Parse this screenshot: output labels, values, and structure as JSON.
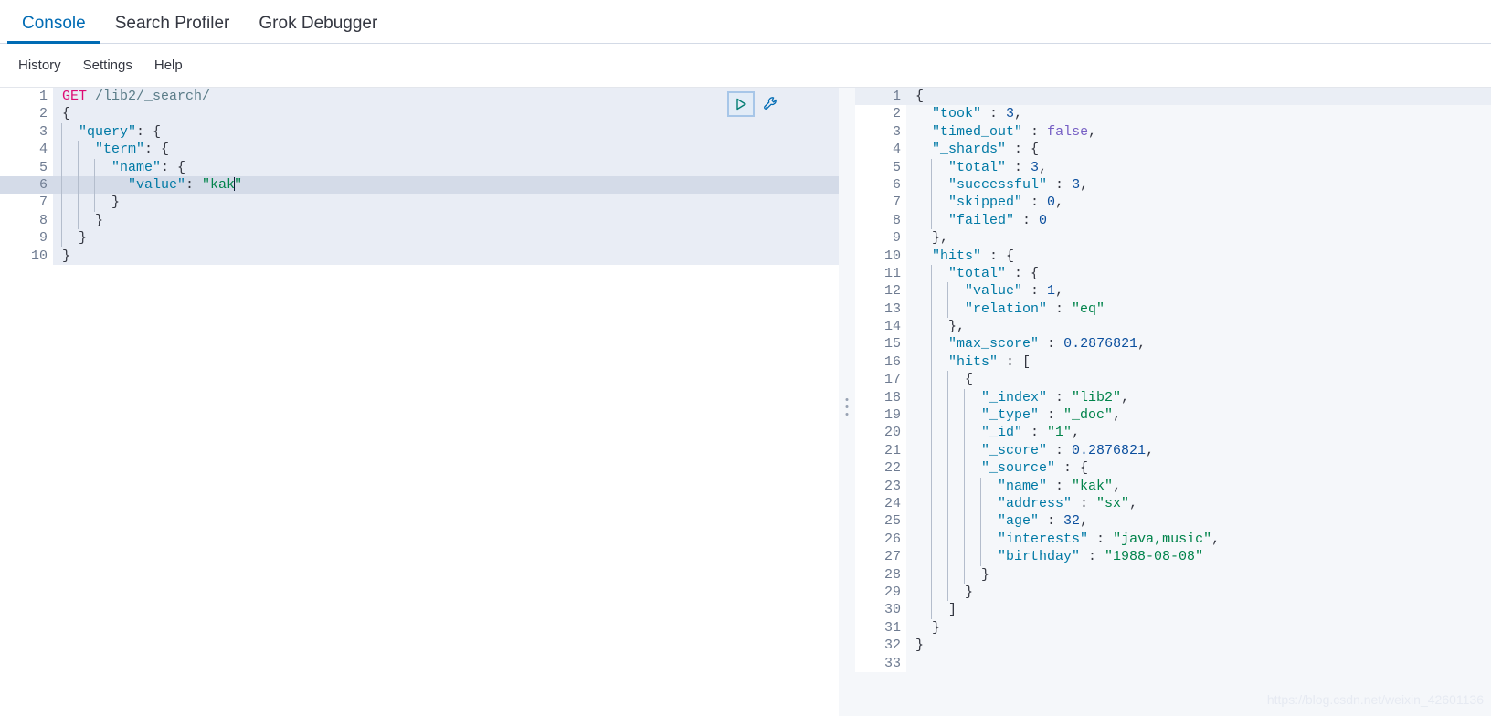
{
  "app": {
    "tabs": [
      {
        "label": "Console",
        "active": true
      },
      {
        "label": "Search Profiler",
        "active": false
      },
      {
        "label": "Grok Debugger",
        "active": false
      }
    ],
    "sub_nav": [
      {
        "label": "History"
      },
      {
        "label": "Settings"
      },
      {
        "label": "Help"
      }
    ],
    "watermark": "https://blog.csdn.net/weixin_42601136",
    "colors": {
      "accent": "#006bb4",
      "method": "#dd0a73",
      "key": "#0079a5",
      "string": "#00834a",
      "number": "#0b4f9e",
      "boolean": "#765fc4",
      "play_icon": "#017d73",
      "wrench_icon": "#006bb4",
      "active_line": "#d4dbe8",
      "request_block": "#e9edf5",
      "output_bg": "#f5f7fa"
    }
  },
  "toolbar": {
    "play_label": "Click to send request",
    "wrench_label": "Open documentation / settings"
  },
  "request_editor": {
    "name": "console-request-editor",
    "cursor_line": 6,
    "lines": [
      {
        "n": 1,
        "fold": "",
        "indent": 0,
        "tokens": [
          {
            "t": "method",
            "v": "GET"
          },
          {
            "t": "plain",
            "v": " "
          },
          {
            "t": "url",
            "v": "/lib2/_search/"
          }
        ]
      },
      {
        "n": 2,
        "fold": "open",
        "indent": 0,
        "tokens": [
          {
            "t": "punc",
            "v": "{"
          }
        ]
      },
      {
        "n": 3,
        "fold": "open",
        "indent": 1,
        "tokens": [
          {
            "t": "plain",
            "v": "  "
          },
          {
            "t": "key",
            "v": "\"query\""
          },
          {
            "t": "punc",
            "v": ": {"
          }
        ]
      },
      {
        "n": 4,
        "fold": "open",
        "indent": 2,
        "tokens": [
          {
            "t": "plain",
            "v": "    "
          },
          {
            "t": "key",
            "v": "\"term\""
          },
          {
            "t": "punc",
            "v": ": {"
          }
        ]
      },
      {
        "n": 5,
        "fold": "open",
        "indent": 3,
        "tokens": [
          {
            "t": "plain",
            "v": "      "
          },
          {
            "t": "key",
            "v": "\"name\""
          },
          {
            "t": "punc",
            "v": ": {"
          }
        ]
      },
      {
        "n": 6,
        "fold": "",
        "indent": 4,
        "tokens": [
          {
            "t": "plain",
            "v": "        "
          },
          {
            "t": "key",
            "v": "\"value\""
          },
          {
            "t": "punc",
            "v": ": "
          },
          {
            "t": "string",
            "v": "\"kak"
          },
          {
            "t": "caret",
            "v": ""
          },
          {
            "t": "string",
            "v": "\""
          }
        ]
      },
      {
        "n": 7,
        "fold": "close",
        "indent": 3,
        "tokens": [
          {
            "t": "plain",
            "v": "      "
          },
          {
            "t": "punc",
            "v": "}"
          }
        ]
      },
      {
        "n": 8,
        "fold": "close",
        "indent": 2,
        "tokens": [
          {
            "t": "plain",
            "v": "    "
          },
          {
            "t": "punc",
            "v": "}"
          }
        ]
      },
      {
        "n": 9,
        "fold": "close",
        "indent": 1,
        "tokens": [
          {
            "t": "plain",
            "v": "  "
          },
          {
            "t": "punc",
            "v": "}"
          }
        ]
      },
      {
        "n": 10,
        "fold": "close",
        "indent": 0,
        "tokens": [
          {
            "t": "punc",
            "v": "}"
          }
        ]
      }
    ],
    "request": {
      "method": "GET",
      "path": "/lib2/_search/",
      "body": {
        "query": {
          "term": {
            "name": {
              "value": "kak"
            }
          }
        }
      }
    }
  },
  "response_editor": {
    "name": "console-response-viewer",
    "cursor_line": 1,
    "lines": [
      {
        "n": 1,
        "fold": "open",
        "indent": 0,
        "tokens": [
          {
            "t": "punc",
            "v": "{"
          }
        ]
      },
      {
        "n": 2,
        "fold": "",
        "indent": 1,
        "tokens": [
          {
            "t": "plain",
            "v": "  "
          },
          {
            "t": "key",
            "v": "\"took\""
          },
          {
            "t": "punc",
            "v": " : "
          },
          {
            "t": "num",
            "v": "3"
          },
          {
            "t": "punc",
            "v": ","
          }
        ]
      },
      {
        "n": 3,
        "fold": "",
        "indent": 1,
        "tokens": [
          {
            "t": "plain",
            "v": "  "
          },
          {
            "t": "key",
            "v": "\"timed_out\""
          },
          {
            "t": "punc",
            "v": " : "
          },
          {
            "t": "bool",
            "v": "false"
          },
          {
            "t": "punc",
            "v": ","
          }
        ]
      },
      {
        "n": 4,
        "fold": "open",
        "indent": 1,
        "tokens": [
          {
            "t": "plain",
            "v": "  "
          },
          {
            "t": "key",
            "v": "\"_shards\""
          },
          {
            "t": "punc",
            "v": " : {"
          }
        ]
      },
      {
        "n": 5,
        "fold": "",
        "indent": 2,
        "tokens": [
          {
            "t": "plain",
            "v": "    "
          },
          {
            "t": "key",
            "v": "\"total\""
          },
          {
            "t": "punc",
            "v": " : "
          },
          {
            "t": "num",
            "v": "3"
          },
          {
            "t": "punc",
            "v": ","
          }
        ]
      },
      {
        "n": 6,
        "fold": "",
        "indent": 2,
        "tokens": [
          {
            "t": "plain",
            "v": "    "
          },
          {
            "t": "key",
            "v": "\"successful\""
          },
          {
            "t": "punc",
            "v": " : "
          },
          {
            "t": "num",
            "v": "3"
          },
          {
            "t": "punc",
            "v": ","
          }
        ]
      },
      {
        "n": 7,
        "fold": "",
        "indent": 2,
        "tokens": [
          {
            "t": "plain",
            "v": "    "
          },
          {
            "t": "key",
            "v": "\"skipped\""
          },
          {
            "t": "punc",
            "v": " : "
          },
          {
            "t": "num",
            "v": "0"
          },
          {
            "t": "punc",
            "v": ","
          }
        ]
      },
      {
        "n": 8,
        "fold": "",
        "indent": 2,
        "tokens": [
          {
            "t": "plain",
            "v": "    "
          },
          {
            "t": "key",
            "v": "\"failed\""
          },
          {
            "t": "punc",
            "v": " : "
          },
          {
            "t": "num",
            "v": "0"
          }
        ]
      },
      {
        "n": 9,
        "fold": "close",
        "indent": 1,
        "tokens": [
          {
            "t": "plain",
            "v": "  "
          },
          {
            "t": "punc",
            "v": "},"
          }
        ]
      },
      {
        "n": 10,
        "fold": "open",
        "indent": 1,
        "tokens": [
          {
            "t": "plain",
            "v": "  "
          },
          {
            "t": "key",
            "v": "\"hits\""
          },
          {
            "t": "punc",
            "v": " : {"
          }
        ]
      },
      {
        "n": 11,
        "fold": "open",
        "indent": 2,
        "tokens": [
          {
            "t": "plain",
            "v": "    "
          },
          {
            "t": "key",
            "v": "\"total\""
          },
          {
            "t": "punc",
            "v": " : {"
          }
        ]
      },
      {
        "n": 12,
        "fold": "",
        "indent": 3,
        "tokens": [
          {
            "t": "plain",
            "v": "      "
          },
          {
            "t": "key",
            "v": "\"value\""
          },
          {
            "t": "punc",
            "v": " : "
          },
          {
            "t": "num",
            "v": "1"
          },
          {
            "t": "punc",
            "v": ","
          }
        ]
      },
      {
        "n": 13,
        "fold": "",
        "indent": 3,
        "tokens": [
          {
            "t": "plain",
            "v": "      "
          },
          {
            "t": "key",
            "v": "\"relation\""
          },
          {
            "t": "punc",
            "v": " : "
          },
          {
            "t": "string",
            "v": "\"eq\""
          }
        ]
      },
      {
        "n": 14,
        "fold": "close",
        "indent": 2,
        "tokens": [
          {
            "t": "plain",
            "v": "    "
          },
          {
            "t": "punc",
            "v": "},"
          }
        ]
      },
      {
        "n": 15,
        "fold": "",
        "indent": 2,
        "tokens": [
          {
            "t": "plain",
            "v": "    "
          },
          {
            "t": "key",
            "v": "\"max_score\""
          },
          {
            "t": "punc",
            "v": " : "
          },
          {
            "t": "num",
            "v": "0.2876821"
          },
          {
            "t": "punc",
            "v": ","
          }
        ]
      },
      {
        "n": 16,
        "fold": "open",
        "indent": 2,
        "tokens": [
          {
            "t": "plain",
            "v": "    "
          },
          {
            "t": "key",
            "v": "\"hits\""
          },
          {
            "t": "punc",
            "v": " : ["
          }
        ]
      },
      {
        "n": 17,
        "fold": "open",
        "indent": 3,
        "tokens": [
          {
            "t": "plain",
            "v": "      "
          },
          {
            "t": "punc",
            "v": "{"
          }
        ]
      },
      {
        "n": 18,
        "fold": "",
        "indent": 4,
        "tokens": [
          {
            "t": "plain",
            "v": "        "
          },
          {
            "t": "key",
            "v": "\"_index\""
          },
          {
            "t": "punc",
            "v": " : "
          },
          {
            "t": "string",
            "v": "\"lib2\""
          },
          {
            "t": "punc",
            "v": ","
          }
        ]
      },
      {
        "n": 19,
        "fold": "",
        "indent": 4,
        "tokens": [
          {
            "t": "plain",
            "v": "        "
          },
          {
            "t": "key",
            "v": "\"_type\""
          },
          {
            "t": "punc",
            "v": " : "
          },
          {
            "t": "string",
            "v": "\"_doc\""
          },
          {
            "t": "punc",
            "v": ","
          }
        ]
      },
      {
        "n": 20,
        "fold": "",
        "indent": 4,
        "tokens": [
          {
            "t": "plain",
            "v": "        "
          },
          {
            "t": "key",
            "v": "\"_id\""
          },
          {
            "t": "punc",
            "v": " : "
          },
          {
            "t": "string",
            "v": "\"1\""
          },
          {
            "t": "punc",
            "v": ","
          }
        ]
      },
      {
        "n": 21,
        "fold": "",
        "indent": 4,
        "tokens": [
          {
            "t": "plain",
            "v": "        "
          },
          {
            "t": "key",
            "v": "\"_score\""
          },
          {
            "t": "punc",
            "v": " : "
          },
          {
            "t": "num",
            "v": "0.2876821"
          },
          {
            "t": "punc",
            "v": ","
          }
        ]
      },
      {
        "n": 22,
        "fold": "open",
        "indent": 4,
        "tokens": [
          {
            "t": "plain",
            "v": "        "
          },
          {
            "t": "key",
            "v": "\"_source\""
          },
          {
            "t": "punc",
            "v": " : {"
          }
        ]
      },
      {
        "n": 23,
        "fold": "",
        "indent": 5,
        "tokens": [
          {
            "t": "plain",
            "v": "          "
          },
          {
            "t": "key",
            "v": "\"name\""
          },
          {
            "t": "punc",
            "v": " : "
          },
          {
            "t": "string",
            "v": "\"kak\""
          },
          {
            "t": "punc",
            "v": ","
          }
        ]
      },
      {
        "n": 24,
        "fold": "",
        "indent": 5,
        "tokens": [
          {
            "t": "plain",
            "v": "          "
          },
          {
            "t": "key",
            "v": "\"address\""
          },
          {
            "t": "punc",
            "v": " : "
          },
          {
            "t": "string",
            "v": "\"sx\""
          },
          {
            "t": "punc",
            "v": ","
          }
        ]
      },
      {
        "n": 25,
        "fold": "",
        "indent": 5,
        "tokens": [
          {
            "t": "plain",
            "v": "          "
          },
          {
            "t": "key",
            "v": "\"age\""
          },
          {
            "t": "punc",
            "v": " : "
          },
          {
            "t": "num",
            "v": "32"
          },
          {
            "t": "punc",
            "v": ","
          }
        ]
      },
      {
        "n": 26,
        "fold": "",
        "indent": 5,
        "tokens": [
          {
            "t": "plain",
            "v": "          "
          },
          {
            "t": "key",
            "v": "\"interests\""
          },
          {
            "t": "punc",
            "v": " : "
          },
          {
            "t": "string",
            "v": "\"java,music\""
          },
          {
            "t": "punc",
            "v": ","
          }
        ]
      },
      {
        "n": 27,
        "fold": "",
        "indent": 5,
        "tokens": [
          {
            "t": "plain",
            "v": "          "
          },
          {
            "t": "key",
            "v": "\"birthday\""
          },
          {
            "t": "punc",
            "v": " : "
          },
          {
            "t": "string",
            "v": "\"1988-08-08\""
          }
        ]
      },
      {
        "n": 28,
        "fold": "close",
        "indent": 4,
        "tokens": [
          {
            "t": "plain",
            "v": "        "
          },
          {
            "t": "punc",
            "v": "}"
          }
        ]
      },
      {
        "n": 29,
        "fold": "close",
        "indent": 3,
        "tokens": [
          {
            "t": "plain",
            "v": "      "
          },
          {
            "t": "punc",
            "v": "}"
          }
        ]
      },
      {
        "n": 30,
        "fold": "close",
        "indent": 2,
        "tokens": [
          {
            "t": "plain",
            "v": "    "
          },
          {
            "t": "punc",
            "v": "]"
          }
        ]
      },
      {
        "n": 31,
        "fold": "close",
        "indent": 1,
        "tokens": [
          {
            "t": "plain",
            "v": "  "
          },
          {
            "t": "punc",
            "v": "}"
          }
        ]
      },
      {
        "n": 32,
        "fold": "close",
        "indent": 0,
        "tokens": [
          {
            "t": "punc",
            "v": "}"
          }
        ]
      },
      {
        "n": 33,
        "fold": "",
        "indent": 0,
        "tokens": []
      }
    ],
    "response": {
      "took": 3,
      "timed_out": false,
      "_shards": {
        "total": 3,
        "successful": 3,
        "skipped": 0,
        "failed": 0
      },
      "hits": {
        "total": {
          "value": 1,
          "relation": "eq"
        },
        "max_score": 0.2876821,
        "hits": [
          {
            "_index": "lib2",
            "_type": "_doc",
            "_id": "1",
            "_score": 0.2876821,
            "_source": {
              "name": "kak",
              "address": "sx",
              "age": 32,
              "interests": "java,music",
              "birthday": "1988-08-08"
            }
          }
        ]
      }
    }
  }
}
